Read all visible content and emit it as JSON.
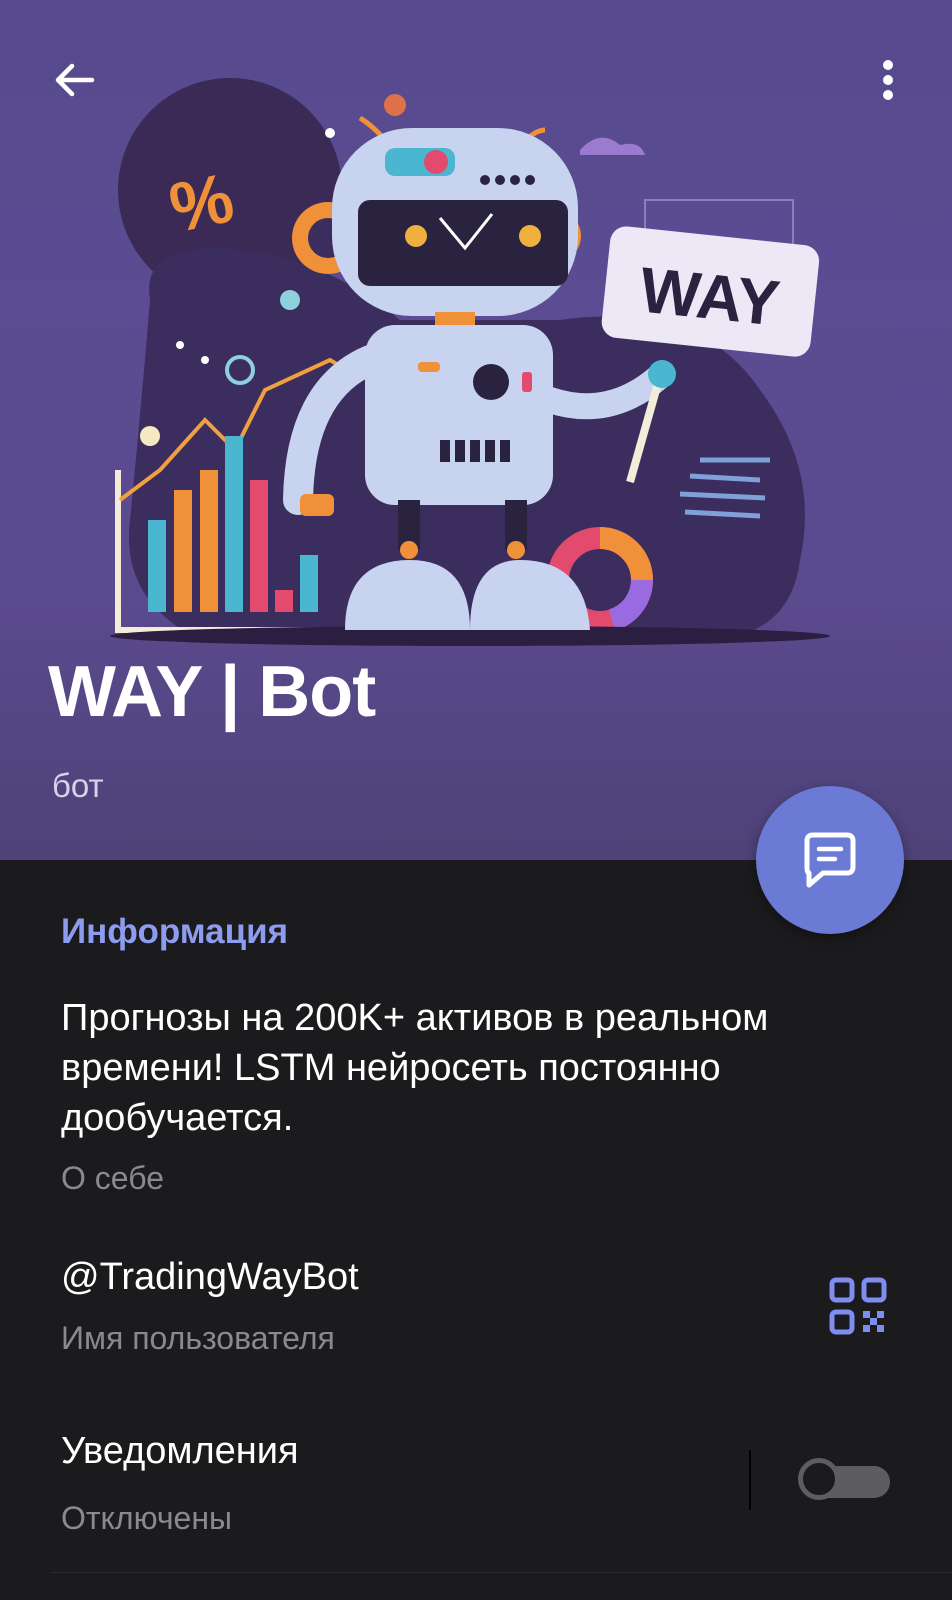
{
  "header": {
    "title": "WAY | Bot",
    "subtitle": "бот",
    "back_icon": "arrow-left-icon",
    "menu_icon": "more-vertical-icon",
    "avatar_sign_text": "WAY"
  },
  "fab": {
    "icon": "message-icon"
  },
  "info": {
    "section_title": "Информация",
    "about_text": "Прогнозы на 200K+ активов в реальном времени! LSTM нейросеть постоянно дообучается.",
    "about_label": "О себе",
    "username": "@TradingWayBot",
    "username_label": "Имя пользователя",
    "qr_icon": "qr-code-icon",
    "notifications": "Уведомления",
    "notifications_status": "Отключены",
    "notifications_enabled": false
  },
  "colors": {
    "header_bg": "#5a4a8e",
    "accent": "#6b7ad4",
    "section_title": "#8e9cf0",
    "page_bg": "#1b1b1d"
  }
}
